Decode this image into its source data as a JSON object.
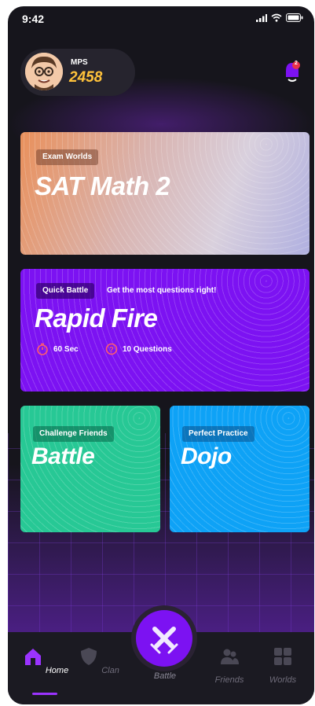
{
  "status": {
    "time": "9:42"
  },
  "profile": {
    "mps_label": "MPS",
    "mps_value": "2458",
    "notification_count": "2"
  },
  "cards": {
    "sat": {
      "tag": "Exam Worlds",
      "title": "SAT Math 2"
    },
    "rapid": {
      "tag": "Quick Battle",
      "subtitle": "Get the most questions right!",
      "title": "Rapid Fire",
      "timer": "60 Sec",
      "questions": "10 Questions"
    },
    "battle": {
      "tag": "Challenge Friends",
      "title": "Battle"
    },
    "dojo": {
      "tag": "Perfect Practice",
      "title": "Dojo"
    }
  },
  "nav": {
    "items": [
      {
        "label": "Home",
        "icon": "home-icon",
        "active": true
      },
      {
        "label": "Clan",
        "icon": "shield-icon",
        "active": false
      },
      {
        "label": "Battle",
        "icon": "crossed-swords-icon",
        "active": false
      },
      {
        "label": "Friends",
        "icon": "friends-icon",
        "active": false
      },
      {
        "label": "Worlds",
        "icon": "grid-icon",
        "active": false
      }
    ]
  },
  "colors": {
    "background": "#16151c",
    "purple": "#7c12f2",
    "green": "#27c895",
    "blue": "#0ea2f6",
    "gold": "#ffc23b"
  }
}
